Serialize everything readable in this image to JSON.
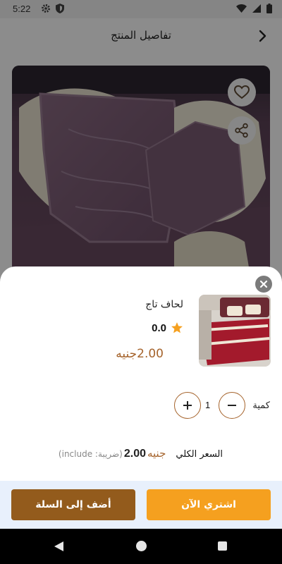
{
  "status_bar": {
    "time": "5:22"
  },
  "app_bar": {
    "title": "تفاصيل المنتج"
  },
  "sheet": {
    "product_name": "لحاف تاج",
    "rating": "0.0",
    "unit_price": "2.00جنيه",
    "quantity_label": "كمية",
    "quantity": "1",
    "total_label": "السعر الكلي",
    "total_currency": "جنيه",
    "total_amount": "2.00",
    "total_tax_note": "(ضريبة: include)",
    "add_to_cart_label": "أضف إلى السلة",
    "buy_now_label": "اشتري الآن"
  },
  "colors": {
    "accent_brown": "#a5632b",
    "add_to_cart": "#935b1c",
    "buy_now": "#f5a01f",
    "star": "#f5a01f"
  },
  "icons": [
    "settings-icon",
    "shield-icon",
    "wifi-icon",
    "signal-icon",
    "battery-icon",
    "chevron-right-icon",
    "heart-icon",
    "share-icon",
    "close-icon",
    "star-icon",
    "minus-icon",
    "plus-icon",
    "nav-back-icon",
    "nav-home-icon",
    "nav-recents-icon"
  ]
}
